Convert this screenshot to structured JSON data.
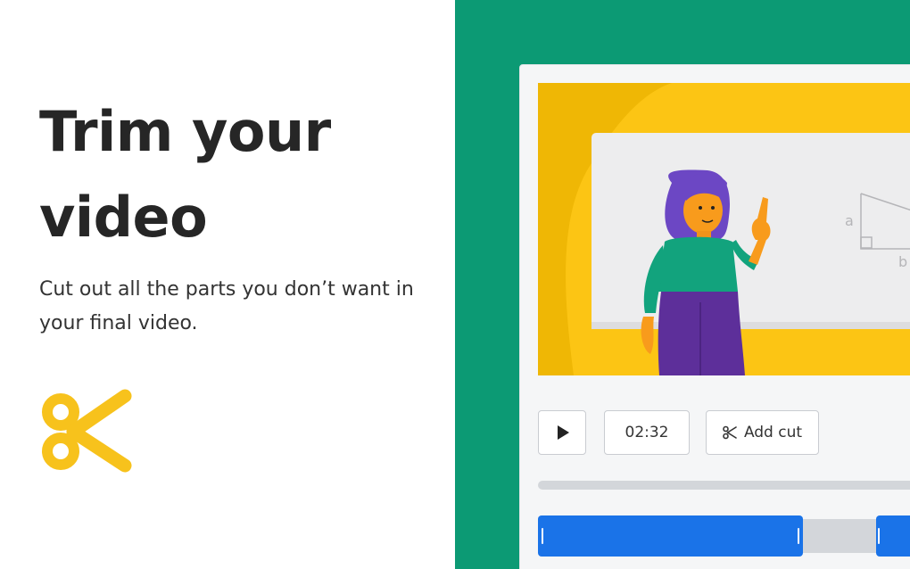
{
  "hero": {
    "headline": "Trim your video",
    "subtext": "Cut out all the parts you don’t want in your final video."
  },
  "editor": {
    "play_icon": "play-icon",
    "time_display": "02:32",
    "add_cut_label": "Add cut",
    "add_cut_icon": "scissors-icon",
    "whiteboard_labels": {
      "a": "a",
      "b": "b"
    }
  },
  "colors": {
    "brand_green": "#0c9a74",
    "accent_yellow": "#f7c21c",
    "timeline_blue": "#1a73e8"
  }
}
